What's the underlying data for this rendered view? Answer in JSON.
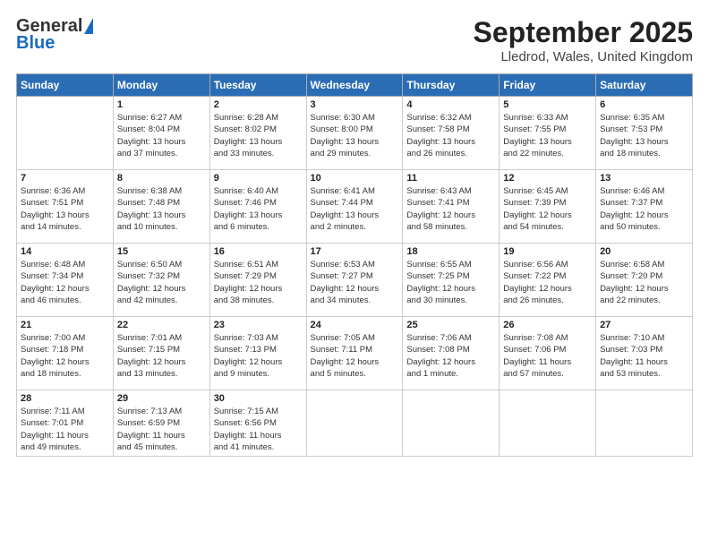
{
  "header": {
    "logo": {
      "general": "General",
      "blue": "Blue"
    },
    "title": "September 2025",
    "location": "Lledrod, Wales, United Kingdom"
  },
  "weekdays": [
    "Sunday",
    "Monday",
    "Tuesday",
    "Wednesday",
    "Thursday",
    "Friday",
    "Saturday"
  ],
  "weeks": [
    [
      {
        "day": "",
        "lines": []
      },
      {
        "day": "1",
        "lines": [
          "Sunrise: 6:27 AM",
          "Sunset: 8:04 PM",
          "Daylight: 13 hours",
          "and 37 minutes."
        ]
      },
      {
        "day": "2",
        "lines": [
          "Sunrise: 6:28 AM",
          "Sunset: 8:02 PM",
          "Daylight: 13 hours",
          "and 33 minutes."
        ]
      },
      {
        "day": "3",
        "lines": [
          "Sunrise: 6:30 AM",
          "Sunset: 8:00 PM",
          "Daylight: 13 hours",
          "and 29 minutes."
        ]
      },
      {
        "day": "4",
        "lines": [
          "Sunrise: 6:32 AM",
          "Sunset: 7:58 PM",
          "Daylight: 13 hours",
          "and 26 minutes."
        ]
      },
      {
        "day": "5",
        "lines": [
          "Sunrise: 6:33 AM",
          "Sunset: 7:55 PM",
          "Daylight: 13 hours",
          "and 22 minutes."
        ]
      },
      {
        "day": "6",
        "lines": [
          "Sunrise: 6:35 AM",
          "Sunset: 7:53 PM",
          "Daylight: 13 hours",
          "and 18 minutes."
        ]
      }
    ],
    [
      {
        "day": "7",
        "lines": [
          "Sunrise: 6:36 AM",
          "Sunset: 7:51 PM",
          "Daylight: 13 hours",
          "and 14 minutes."
        ]
      },
      {
        "day": "8",
        "lines": [
          "Sunrise: 6:38 AM",
          "Sunset: 7:48 PM",
          "Daylight: 13 hours",
          "and 10 minutes."
        ]
      },
      {
        "day": "9",
        "lines": [
          "Sunrise: 6:40 AM",
          "Sunset: 7:46 PM",
          "Daylight: 13 hours",
          "and 6 minutes."
        ]
      },
      {
        "day": "10",
        "lines": [
          "Sunrise: 6:41 AM",
          "Sunset: 7:44 PM",
          "Daylight: 13 hours",
          "and 2 minutes."
        ]
      },
      {
        "day": "11",
        "lines": [
          "Sunrise: 6:43 AM",
          "Sunset: 7:41 PM",
          "Daylight: 12 hours",
          "and 58 minutes."
        ]
      },
      {
        "day": "12",
        "lines": [
          "Sunrise: 6:45 AM",
          "Sunset: 7:39 PM",
          "Daylight: 12 hours",
          "and 54 minutes."
        ]
      },
      {
        "day": "13",
        "lines": [
          "Sunrise: 6:46 AM",
          "Sunset: 7:37 PM",
          "Daylight: 12 hours",
          "and 50 minutes."
        ]
      }
    ],
    [
      {
        "day": "14",
        "lines": [
          "Sunrise: 6:48 AM",
          "Sunset: 7:34 PM",
          "Daylight: 12 hours",
          "and 46 minutes."
        ]
      },
      {
        "day": "15",
        "lines": [
          "Sunrise: 6:50 AM",
          "Sunset: 7:32 PM",
          "Daylight: 12 hours",
          "and 42 minutes."
        ]
      },
      {
        "day": "16",
        "lines": [
          "Sunrise: 6:51 AM",
          "Sunset: 7:29 PM",
          "Daylight: 12 hours",
          "and 38 minutes."
        ]
      },
      {
        "day": "17",
        "lines": [
          "Sunrise: 6:53 AM",
          "Sunset: 7:27 PM",
          "Daylight: 12 hours",
          "and 34 minutes."
        ]
      },
      {
        "day": "18",
        "lines": [
          "Sunrise: 6:55 AM",
          "Sunset: 7:25 PM",
          "Daylight: 12 hours",
          "and 30 minutes."
        ]
      },
      {
        "day": "19",
        "lines": [
          "Sunrise: 6:56 AM",
          "Sunset: 7:22 PM",
          "Daylight: 12 hours",
          "and 26 minutes."
        ]
      },
      {
        "day": "20",
        "lines": [
          "Sunrise: 6:58 AM",
          "Sunset: 7:20 PM",
          "Daylight: 12 hours",
          "and 22 minutes."
        ]
      }
    ],
    [
      {
        "day": "21",
        "lines": [
          "Sunrise: 7:00 AM",
          "Sunset: 7:18 PM",
          "Daylight: 12 hours",
          "and 18 minutes."
        ]
      },
      {
        "day": "22",
        "lines": [
          "Sunrise: 7:01 AM",
          "Sunset: 7:15 PM",
          "Daylight: 12 hours",
          "and 13 minutes."
        ]
      },
      {
        "day": "23",
        "lines": [
          "Sunrise: 7:03 AM",
          "Sunset: 7:13 PM",
          "Daylight: 12 hours",
          "and 9 minutes."
        ]
      },
      {
        "day": "24",
        "lines": [
          "Sunrise: 7:05 AM",
          "Sunset: 7:11 PM",
          "Daylight: 12 hours",
          "and 5 minutes."
        ]
      },
      {
        "day": "25",
        "lines": [
          "Sunrise: 7:06 AM",
          "Sunset: 7:08 PM",
          "Daylight: 12 hours",
          "and 1 minute."
        ]
      },
      {
        "day": "26",
        "lines": [
          "Sunrise: 7:08 AM",
          "Sunset: 7:06 PM",
          "Daylight: 11 hours",
          "and 57 minutes."
        ]
      },
      {
        "day": "27",
        "lines": [
          "Sunrise: 7:10 AM",
          "Sunset: 7:03 PM",
          "Daylight: 11 hours",
          "and 53 minutes."
        ]
      }
    ],
    [
      {
        "day": "28",
        "lines": [
          "Sunrise: 7:11 AM",
          "Sunset: 7:01 PM",
          "Daylight: 11 hours",
          "and 49 minutes."
        ]
      },
      {
        "day": "29",
        "lines": [
          "Sunrise: 7:13 AM",
          "Sunset: 6:59 PM",
          "Daylight: 11 hours",
          "and 45 minutes."
        ]
      },
      {
        "day": "30",
        "lines": [
          "Sunrise: 7:15 AM",
          "Sunset: 6:56 PM",
          "Daylight: 11 hours",
          "and 41 minutes."
        ]
      },
      {
        "day": "",
        "lines": []
      },
      {
        "day": "",
        "lines": []
      },
      {
        "day": "",
        "lines": []
      },
      {
        "day": "",
        "lines": []
      }
    ]
  ]
}
